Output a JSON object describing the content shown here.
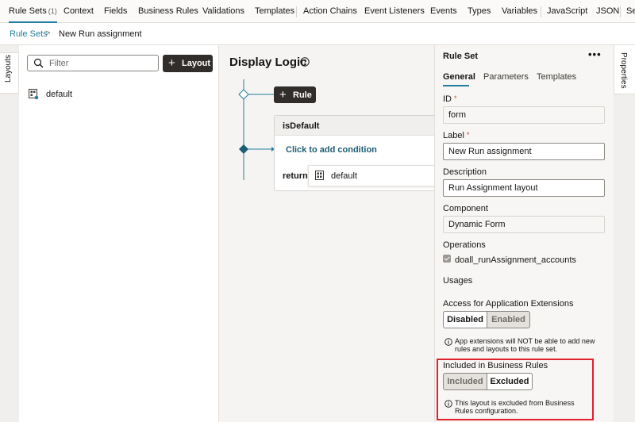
{
  "top_tabs": {
    "rule_sets": "Rule Sets",
    "rule_sets_count": "(1)",
    "context": "Context",
    "fields": "Fields",
    "business_rules": "Business Rules",
    "validations": "Validations",
    "templates": "Templates",
    "action_chains": "Action Chains",
    "event_listeners": "Event Listeners",
    "events": "Events",
    "types": "Types",
    "variables": "Variables",
    "javascript": "JavaScript",
    "json": "JSON",
    "settings_partial": "Se"
  },
  "breadcrumb": {
    "parent": "Rule Sets",
    "separator": ">",
    "current": "New Run assignment"
  },
  "left_rail": {
    "layouts_label": "Layouts"
  },
  "layouts_panel": {
    "filter_placeholder": "Filter",
    "add_layout_label": "Layout",
    "items": [
      "default"
    ]
  },
  "display_logic": {
    "title": "Display Logic",
    "rule_button": "Rule",
    "case_title": "isDefault",
    "add_condition": "Click to add condition",
    "return_label": "return",
    "return_value": "default"
  },
  "properties": {
    "title": "Rule Set",
    "more": "•••",
    "tabs": {
      "general": "General",
      "parameters": "Parameters",
      "templates": "Templates"
    },
    "id_label": "ID",
    "id_value": "form",
    "required_mark": "*",
    "label_label": "Label",
    "label_value": "New Run assignment",
    "description_label": "Description",
    "description_value": "Run Assignment layout",
    "component_label": "Component",
    "component_value": "Dynamic Form",
    "operations_label": "Operations",
    "operation_value": "doall_runAssignment_accounts",
    "usages_label": "Usages",
    "access_label": "Access for Application Extensions",
    "access_disabled": "Disabled",
    "access_enabled": "Enabled",
    "access_info": "App extensions will NOT be able to add new rules and layouts to this rule set.",
    "included_label": "Included in Business Rules",
    "included": "Included",
    "excluded": "Excluded",
    "included_info": "This layout is excluded from Business Rules configuration."
  },
  "right_rail": {
    "properties_label": "Properties"
  },
  "colors": {
    "accent": "#227e9e",
    "dark_button": "#312d2a",
    "highlight": "#e0202a",
    "link": "#1c5c74"
  }
}
